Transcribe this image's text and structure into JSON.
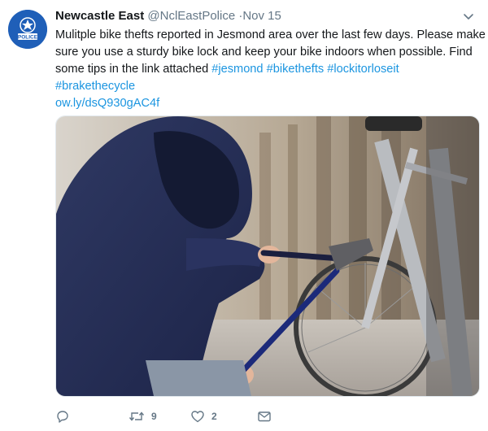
{
  "tweet": {
    "author_name": "Newcastle East",
    "handle": "@NclEastPolice",
    "separator": "·",
    "date": "Nov 15",
    "avatar_text": "POLICE",
    "text_lines": [
      "Mulitple bike thefts reported in Jesmond area over the last few days. Please make",
      "sure you use a sturdy bike lock and keep your bike indoors when possible. Find",
      "some tips in the link attached"
    ],
    "hashtags": [
      "#jesmond",
      "#bikethefts",
      "#lockitorloseit",
      "#brakethecycle"
    ],
    "link": "ow.ly/dsQ930gAC4f",
    "media_description_icon": "photo-hooded-thief-cutting-bike-lock",
    "retweet_count": "9",
    "like_count": "2"
  },
  "colors": {
    "link": "#1b95e0",
    "muted": "#657786",
    "avatar_bg": "#1f5fb8"
  },
  "icons": {
    "reply": "reply-icon",
    "retweet": "retweet-icon",
    "like": "heart-icon",
    "dm": "envelope-icon",
    "menu": "chevron-down-icon"
  }
}
